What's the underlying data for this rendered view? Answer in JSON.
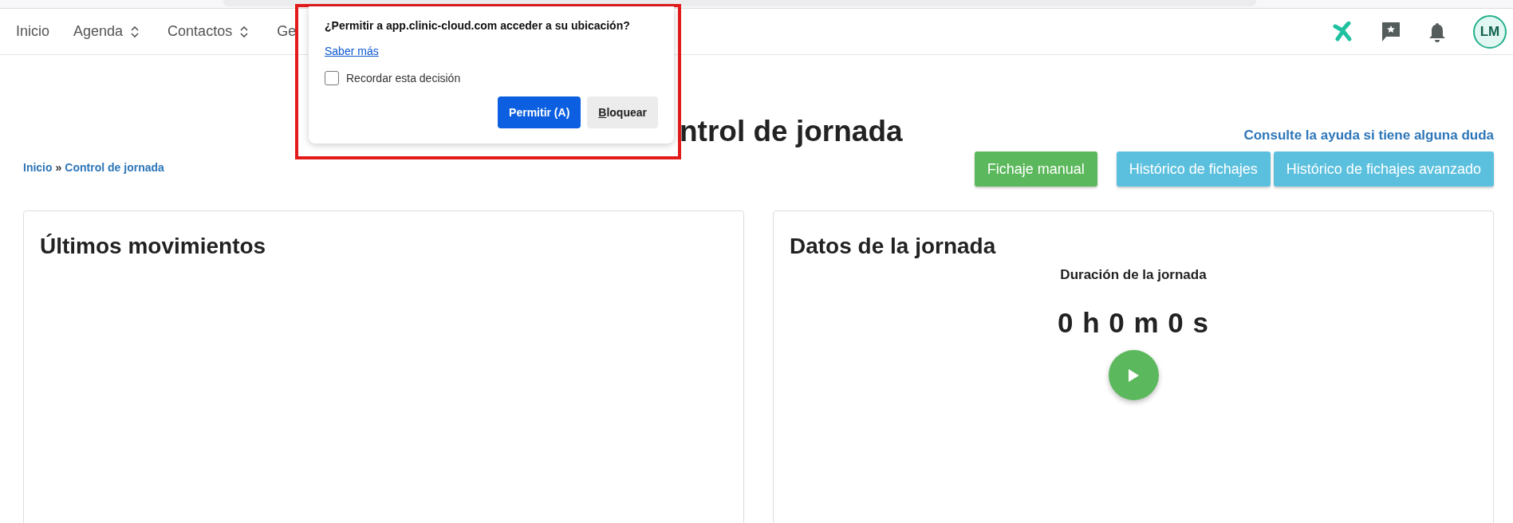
{
  "nav": {
    "items": [
      {
        "label": "Inicio",
        "kind": "link"
      },
      {
        "label": "Agenda",
        "kind": "dropdown"
      },
      {
        "label": "Contactos",
        "kind": "dropdown"
      },
      {
        "label": "Ge",
        "kind": "link"
      }
    ],
    "avatar": "LM"
  },
  "permission_popup": {
    "question": "¿Permitir a app.clinic-cloud.com acceder a su ubicación?",
    "learn_more": "Saber más",
    "remember": {
      "label": "Recordar esta decisión",
      "checked": false
    },
    "buttons": [
      {
        "label": "Permitir (A)",
        "kind": "primary"
      },
      {
        "label": "Bloquear",
        "kind": "secondary"
      }
    ]
  },
  "page": {
    "title": "ntrol de jornada",
    "help_link": "Consulte la ayuda si tiene alguna duda",
    "breadcrumb": {
      "items": [
        "Inicio",
        "Control de jornada"
      ],
      "separator": "»"
    },
    "actions": [
      {
        "label": "Fichaje manual",
        "kind": "success"
      },
      {
        "label": "Histórico de fichajes",
        "kind": "info"
      },
      {
        "label": "Histórico de fichajes avanzado",
        "kind": "info"
      }
    ]
  },
  "cards": [
    {
      "title": "Últimos movimientos",
      "kind": "movements"
    },
    {
      "title": "Datos de la jornada",
      "kind": "day",
      "duration_label": "Duración de la jornada",
      "duration": "0 h 0 m 0 s"
    }
  ]
}
